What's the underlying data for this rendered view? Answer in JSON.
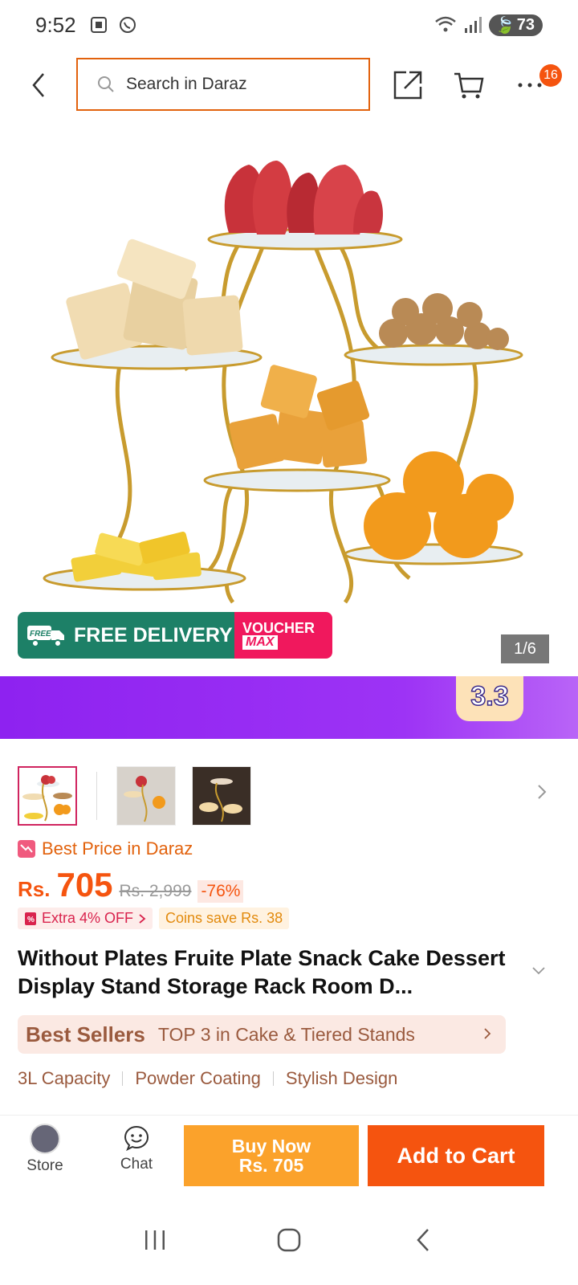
{
  "status_bar": {
    "time": "9:52",
    "battery": "73"
  },
  "header": {
    "search_placeholder": "Search in Daraz",
    "cart_badge": "16"
  },
  "gallery": {
    "page_counter": "1/6",
    "delivery_label": "FREE DELIVERY",
    "delivery_tag": "FREE",
    "voucher_line1": "VOUCHER",
    "voucher_line2": "MAX"
  },
  "promo": {
    "badge": "3.3"
  },
  "price": {
    "best_price_label": "Best Price in Daraz",
    "currency": "Rs.",
    "value": "705",
    "original": "Rs. 2,999",
    "discount": "-76%",
    "extra_off": "Extra 4% OFF",
    "coins": "Coins save Rs. 38"
  },
  "product": {
    "title": "Without Plates Fruite Plate Snack Cake Dessert Display Stand Storage Rack Room D..."
  },
  "best_sellers": {
    "title": "Best Sellers",
    "text": "TOP 3 in Cake & Tiered Stands"
  },
  "features": [
    "3L Capacity",
    "Powder Coating",
    "Stylish Design"
  ],
  "action_bar": {
    "store": "Store",
    "chat": "Chat",
    "buy_now": "Buy Now",
    "buy_now_price": "Rs. 705",
    "add_to_cart": "Add to Cart"
  },
  "colors": {
    "brand_orange": "#f5540f",
    "buy_now": "#fba22b",
    "promo_purple": "#8e22f0",
    "delivery_green": "#1d8067",
    "voucher_pink": "#f0185d"
  }
}
